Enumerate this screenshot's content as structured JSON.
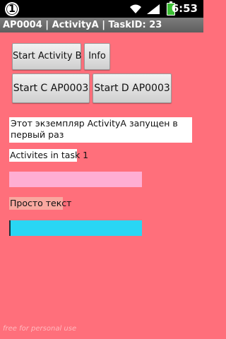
{
  "statusbar": {
    "badge": "1",
    "time": "6:53"
  },
  "titlebar": {
    "text": "AP0004 | ActivityA | TaskID: 23"
  },
  "buttons": {
    "start_b": "Start Activity B",
    "info": "Info",
    "start_c": "Start C AP0003",
    "start_d": "Start D AP0003"
  },
  "message": "Этот экземпляр ActivityA запущен в первый раз",
  "activities": "Activites in task 1",
  "plain_text": "Просто текст",
  "watermark": "free for personal use",
  "colors": {
    "background": "#ff6f7b",
    "pink_bar": "#ffaed3",
    "cyan_field": "#29d6f4",
    "titlebar": "#6b6b6b"
  }
}
